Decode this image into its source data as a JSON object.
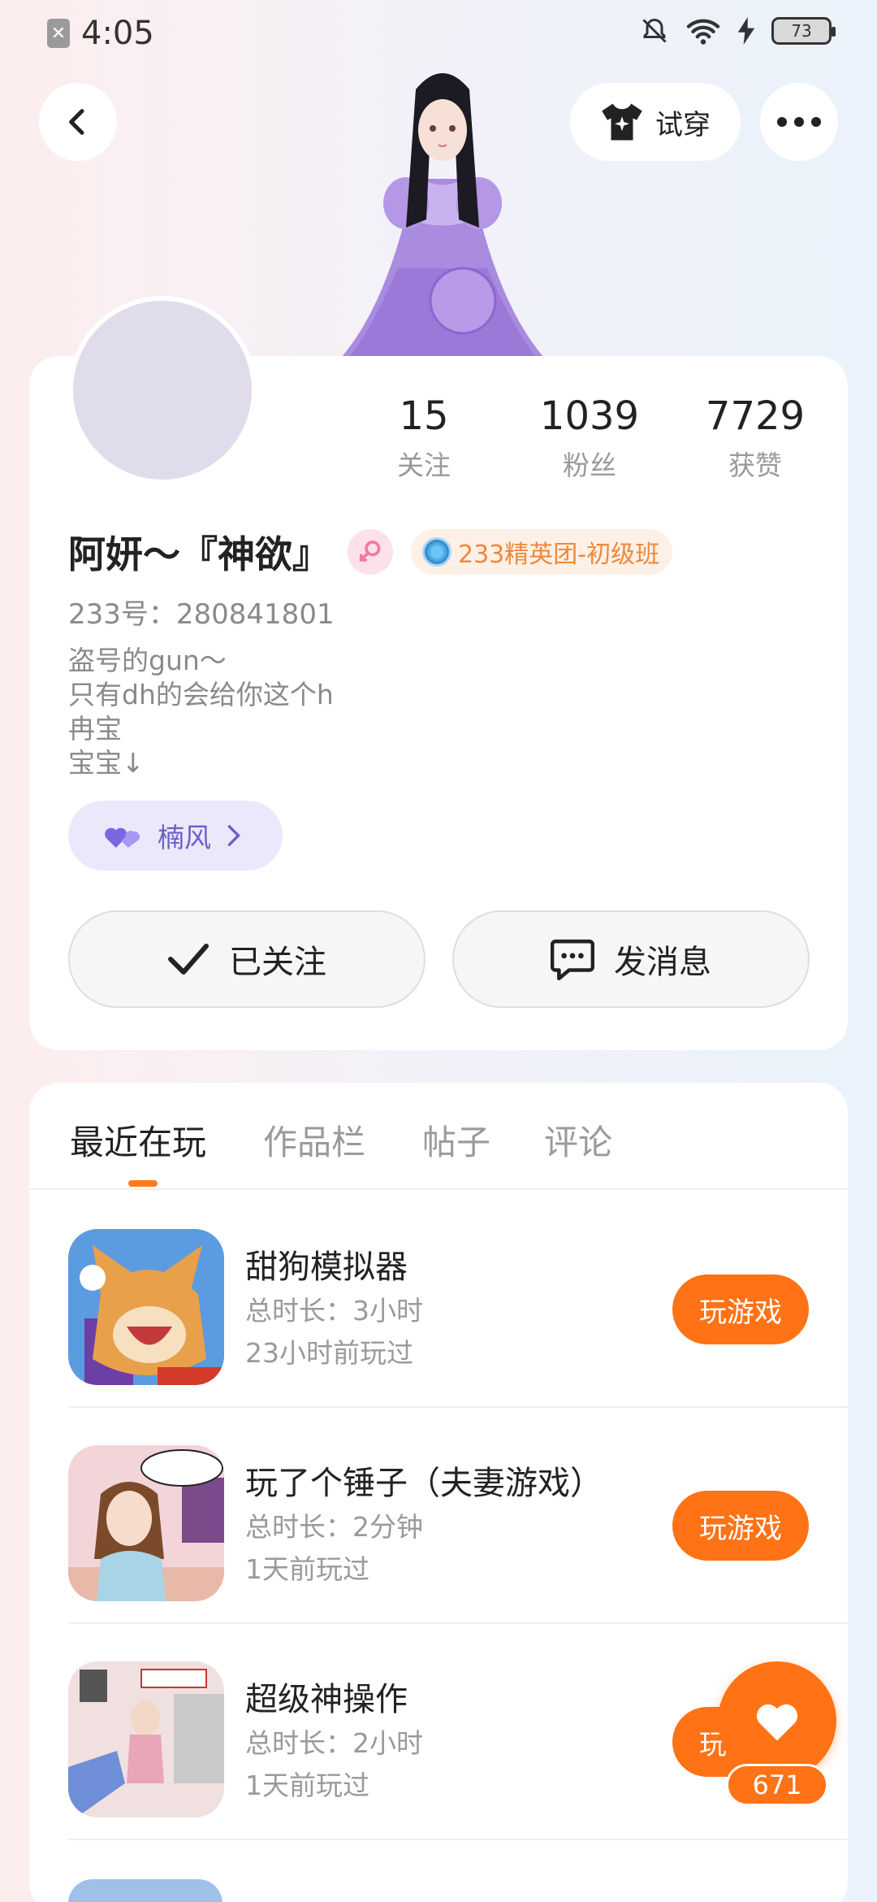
{
  "status": {
    "time": "4:05",
    "battery": "73"
  },
  "header": {
    "tryon_label": "试穿"
  },
  "stats": [
    {
      "num": "15",
      "label": "关注"
    },
    {
      "num": "1039",
      "label": "粉丝"
    },
    {
      "num": "7729",
      "label": "获赞"
    }
  ],
  "profile": {
    "name": "阿妍～『神欲』",
    "badge": "233精英团-初级班",
    "uid": "233号：280841801",
    "bio": [
      "盗号的gun～",
      "只有dh的会给你这个h",
      "冉宝",
      "宝宝↓"
    ],
    "pet_chip": "楠风"
  },
  "actions": {
    "follow": "已关注",
    "message": "发消息"
  },
  "tabs": [
    "最近在玩",
    "作品栏",
    "帖子",
    "评论"
  ],
  "games": [
    {
      "title": "甜狗模拟器",
      "duration": "总时长：3小时",
      "last_played": "23小时前玩过",
      "button": "玩游戏"
    },
    {
      "title": "玩了个锤子（夫妻游戏）",
      "duration": "总时长：2分钟",
      "last_played": "1天前玩过",
      "button": "玩游戏"
    },
    {
      "title": "超级神操作",
      "duration": "总时长：2小时",
      "last_played": "1天前玩过",
      "button": "玩游戏"
    }
  ],
  "favorite": {
    "count": "671"
  },
  "colors": {
    "accent": "#ff7215",
    "badge_text": "#f0883a",
    "pet_chip": "#6b5fc8"
  }
}
